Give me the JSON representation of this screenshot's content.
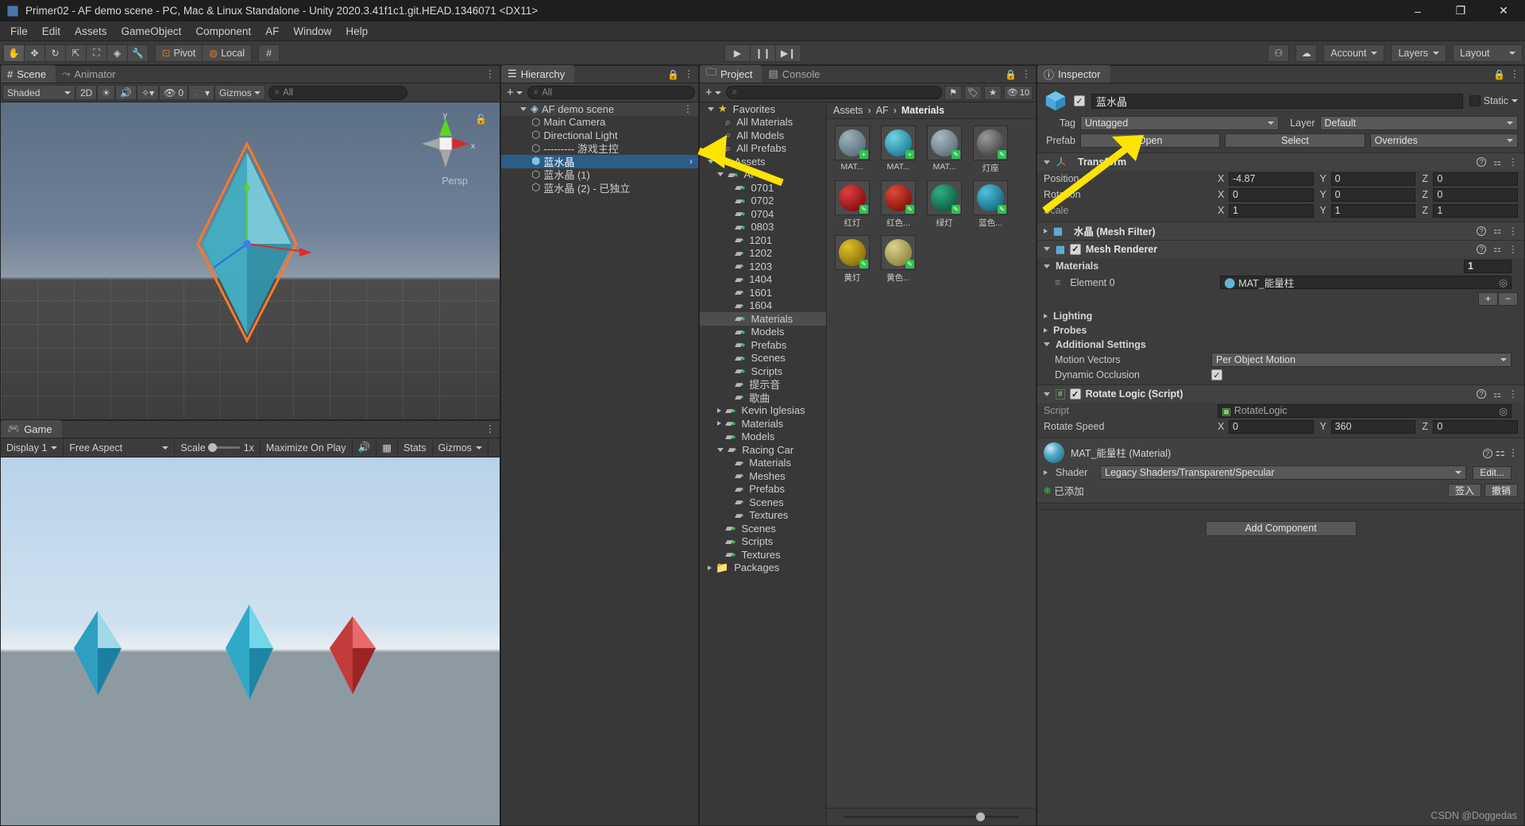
{
  "window": {
    "title": "Primer02 - AF demo scene - PC, Mac & Linux Standalone - Unity 2020.3.41f1c1.git.HEAD.1346071 <DX11>",
    "minimize": "–",
    "maximize": "❐",
    "close": "✕"
  },
  "menubar": {
    "items": [
      "File",
      "Edit",
      "Assets",
      "GameObject",
      "Component",
      "AF",
      "Window",
      "Help"
    ]
  },
  "toolbar": {
    "tools": [
      "hand-tool",
      "move-tool",
      "rotate-tool",
      "scale-tool",
      "rect-tool",
      "transform-tool",
      "custom-tool"
    ],
    "pivot": "Pivot",
    "local": "Local",
    "grid": "grid-snap",
    "play": "▶",
    "pause": "❙❙",
    "step": "▶❙",
    "cloud": "cloud-icon",
    "collab": "collab-icon",
    "account": "Account",
    "layers": "Layers",
    "layout": "Layout"
  },
  "scene": {
    "tab": "Scene",
    "tab2": "Animator",
    "shading": "Shaded",
    "mode2d": "2D",
    "audio_count": "0",
    "gizmos": "Gizmos",
    "search_placeholder": "All",
    "persp_label": "Persp",
    "axis_y": "y",
    "axis_x": "x"
  },
  "game": {
    "tab": "Game",
    "display": "Display 1",
    "aspect": "Free Aspect",
    "scale_label": "Scale",
    "scale_value": "1x",
    "maximize": "Maximize On Play",
    "stats": "Stats",
    "gizmos": "Gizmos"
  },
  "hierarchy": {
    "tab": "Hierarchy",
    "add_label": "+",
    "search_placeholder": "All",
    "items": [
      {
        "label": "AF demo scene",
        "depth": 0,
        "type": "scene",
        "expanded": true,
        "selected": false
      },
      {
        "label": "Main Camera",
        "depth": 1,
        "type": "go",
        "selected": false
      },
      {
        "label": "Directional Light",
        "depth": 1,
        "type": "go",
        "selected": false
      },
      {
        "label": "--------- 游戏主控",
        "depth": 1,
        "type": "go",
        "selected": false
      },
      {
        "label": "蓝水晶",
        "depth": 1,
        "type": "prefab",
        "selected": true
      },
      {
        "label": "蓝水晶 (1)",
        "depth": 1,
        "type": "go",
        "selected": false
      },
      {
        "label": "蓝水晶 (2) - 已独立",
        "depth": 1,
        "type": "go",
        "selected": false
      }
    ]
  },
  "project": {
    "tab": "Project",
    "tab2": "Console",
    "search_placeholder": "",
    "hidden_count": "10",
    "breadcrumb": [
      "Assets",
      "AF",
      "Materials"
    ],
    "tree": [
      {
        "label": "Favorites",
        "depth": 0,
        "icon": "star",
        "expanded": true
      },
      {
        "label": "All Materials",
        "depth": 1,
        "icon": "search"
      },
      {
        "label": "All Models",
        "depth": 1,
        "icon": "search"
      },
      {
        "label": "All Prefabs",
        "depth": 1,
        "icon": "search"
      },
      {
        "label": "Assets",
        "depth": 0,
        "icon": "folder-add",
        "expanded": true
      },
      {
        "label": "AF",
        "depth": 1,
        "icon": "folder-open-add",
        "expanded": true
      },
      {
        "label": "0701",
        "depth": 2,
        "icon": "folder-add"
      },
      {
        "label": "0702",
        "depth": 2,
        "icon": "folder-add"
      },
      {
        "label": "0704",
        "depth": 2,
        "icon": "folder-add"
      },
      {
        "label": "0803",
        "depth": 2,
        "icon": "folder-add"
      },
      {
        "label": "1201",
        "depth": 2,
        "icon": "folder-edit"
      },
      {
        "label": "1202",
        "depth": 2,
        "icon": "folder-edit"
      },
      {
        "label": "1203",
        "depth": 2,
        "icon": "folder-edit"
      },
      {
        "label": "1404",
        "depth": 2,
        "icon": "folder-edit"
      },
      {
        "label": "1601",
        "depth": 2,
        "icon": "folder-edit"
      },
      {
        "label": "1604",
        "depth": 2,
        "icon": "folder-edit"
      },
      {
        "label": "Materials",
        "depth": 2,
        "icon": "folder-add",
        "selected": true
      },
      {
        "label": "Models",
        "depth": 2,
        "icon": "folder-add"
      },
      {
        "label": "Prefabs",
        "depth": 2,
        "icon": "folder-add"
      },
      {
        "label": "Scenes",
        "depth": 2,
        "icon": "folder-add"
      },
      {
        "label": "Scripts",
        "depth": 2,
        "icon": "folder-add"
      },
      {
        "label": "提示音",
        "depth": 2,
        "icon": "folder-edit"
      },
      {
        "label": "歌曲",
        "depth": 2,
        "icon": "folder-edit"
      },
      {
        "label": "Kevin Iglesias",
        "depth": 1,
        "icon": "folder-add",
        "collapsed": true
      },
      {
        "label": "Materials",
        "depth": 1,
        "icon": "folder-add",
        "collapsed": true
      },
      {
        "label": "Models",
        "depth": 1,
        "icon": "folder-add"
      },
      {
        "label": "Racing Car",
        "depth": 1,
        "icon": "folder-open-edit",
        "expanded": true
      },
      {
        "label": "Materials",
        "depth": 2,
        "icon": "folder-edit"
      },
      {
        "label": "Meshes",
        "depth": 2,
        "icon": "folder-edit"
      },
      {
        "label": "Prefabs",
        "depth": 2,
        "icon": "folder-edit"
      },
      {
        "label": "Scenes",
        "depth": 2,
        "icon": "folder-edit"
      },
      {
        "label": "Textures",
        "depth": 2,
        "icon": "folder-edit"
      },
      {
        "label": "Scenes",
        "depth": 1,
        "icon": "folder-add"
      },
      {
        "label": "Scripts",
        "depth": 1,
        "icon": "folder-outline-add"
      },
      {
        "label": "Textures",
        "depth": 1,
        "icon": "folder-add"
      },
      {
        "label": "Packages",
        "depth": 0,
        "icon": "folder-plain",
        "collapsed": true
      }
    ],
    "assets": [
      {
        "name": "MAT...",
        "color1": "#9fb1b8",
        "color2": "#56707d",
        "badge": "add"
      },
      {
        "name": "MAT...",
        "color1": "#6fd3e3",
        "color2": "#1d7b93",
        "badge": "add"
      },
      {
        "name": "MAT...",
        "color1": "#a9bcc2",
        "color2": "#5e7078",
        "badge": "edit"
      },
      {
        "name": "灯座",
        "color1": "#9a9a9a",
        "color2": "#434343",
        "badge": "edit"
      },
      {
        "name": "红灯",
        "color1": "#e04040",
        "color2": "#820d0d",
        "badge": "edit"
      },
      {
        "name": "红色...",
        "color1": "#e04a3a",
        "color2": "#7d1208",
        "badge": "edit"
      },
      {
        "name": "绿灯",
        "color1": "#2fae86",
        "color2": "#0c5b42",
        "badge": "edit"
      },
      {
        "name": "蓝色...",
        "color1": "#4ec0dc",
        "color2": "#16697f",
        "badge": "edit"
      },
      {
        "name": "黄灯",
        "color1": "#ddc02b",
        "color2": "#8a6f06",
        "badge": "edit"
      },
      {
        "name": "黄色...",
        "color1": "#d9d38a",
        "color2": "#8d8440",
        "badge": "edit"
      }
    ]
  },
  "inspector": {
    "tab": "Inspector",
    "object_name": "蓝水晶",
    "static_label": "Static",
    "tag_label": "Tag",
    "tag_value": "Untagged",
    "layer_label": "Layer",
    "layer_value": "Default",
    "prefab_label": "Prefab",
    "prefab_open": "Open",
    "prefab_select": "Select",
    "prefab_overrides": "Overrides",
    "transform": {
      "title": "Transform",
      "rows": [
        {
          "label": "Position",
          "x": "-4.87",
          "y": "0",
          "z": "0",
          "dim": false
        },
        {
          "label": "Rotation",
          "x": "0",
          "y": "0",
          "z": "0",
          "dim": false
        },
        {
          "label": "Scale",
          "x": "1",
          "y": "1",
          "z": "1",
          "dim": true
        }
      ]
    },
    "mesh_filter": {
      "title": "水晶 (Mesh Filter)"
    },
    "mesh_renderer": {
      "title": "Mesh Renderer",
      "materials_label": "Materials",
      "materials_size": "1",
      "element_label": "Element 0",
      "element_value": "MAT_能量柱",
      "add_btn": "+",
      "remove_btn": "−",
      "lighting": "Lighting",
      "probes": "Probes",
      "additional": "Additional Settings",
      "motion_vectors_label": "Motion Vectors",
      "motion_vectors_value": "Per Object Motion",
      "dynamic_occlusion_label": "Dynamic Occlusion",
      "dynamic_occlusion_checked": true
    },
    "rotate_logic": {
      "title": "Rotate Logic (Script)",
      "script_label": "Script",
      "script_value": "RotateLogic",
      "speed_label": "Rotate Speed",
      "speed_x": "0",
      "speed_y": "360",
      "speed_z": "0"
    },
    "material": {
      "title": "MAT_能量柱 (Material)",
      "shader_label": "Shader",
      "shader_value": "Legacy Shaders/Transparent/Specular",
      "edit_btn": "Edit...",
      "added_label": "已添加",
      "checkin_btn": "签入",
      "revert_btn": "撤销"
    },
    "add_component": "Add Component"
  },
  "watermark": "CSDN @Doggedas"
}
